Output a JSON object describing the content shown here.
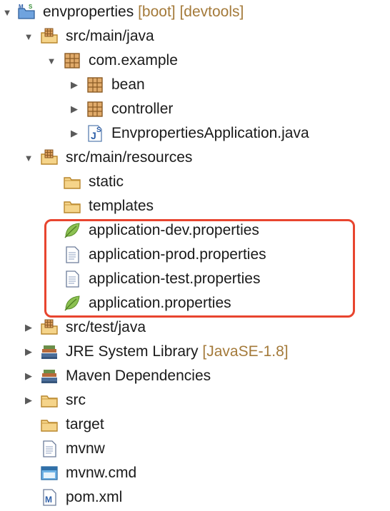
{
  "tree": [
    {
      "depth": 0,
      "arrow": "expanded",
      "icon": "maven-project-icon",
      "label": "envproperties",
      "decoration": "[boot] [devtools]"
    },
    {
      "depth": 1,
      "arrow": "expanded",
      "icon": "source-folder-icon",
      "label": "src/main/java",
      "decoration": ""
    },
    {
      "depth": 2,
      "arrow": "expanded",
      "icon": "package-icon",
      "label": "com.example",
      "decoration": ""
    },
    {
      "depth": 3,
      "arrow": "collapsed",
      "icon": "package-icon",
      "label": "bean",
      "decoration": ""
    },
    {
      "depth": 3,
      "arrow": "collapsed",
      "icon": "package-icon",
      "label": "controller",
      "decoration": ""
    },
    {
      "depth": 3,
      "arrow": "collapsed",
      "icon": "java-file-icon",
      "label": "EnvpropertiesApplication.java",
      "decoration": ""
    },
    {
      "depth": 1,
      "arrow": "expanded",
      "icon": "source-folder-icon",
      "label": "src/main/resources",
      "decoration": ""
    },
    {
      "depth": 2,
      "arrow": "none",
      "icon": "folder-icon",
      "label": "static",
      "decoration": ""
    },
    {
      "depth": 2,
      "arrow": "none",
      "icon": "folder-icon",
      "label": "templates",
      "decoration": ""
    },
    {
      "depth": 2,
      "arrow": "none",
      "icon": "spring-leaf-icon",
      "label": "application-dev.properties",
      "decoration": ""
    },
    {
      "depth": 2,
      "arrow": "none",
      "icon": "text-file-icon",
      "label": "application-prod.properties",
      "decoration": ""
    },
    {
      "depth": 2,
      "arrow": "none",
      "icon": "text-file-icon",
      "label": "application-test.properties",
      "decoration": ""
    },
    {
      "depth": 2,
      "arrow": "none",
      "icon": "spring-leaf-icon",
      "label": "application.properties",
      "decoration": ""
    },
    {
      "depth": 1,
      "arrow": "collapsed",
      "icon": "source-folder-icon",
      "label": "src/test/java",
      "decoration": ""
    },
    {
      "depth": 1,
      "arrow": "collapsed",
      "icon": "library-icon",
      "label": "JRE System Library",
      "decoration": "[JavaSE-1.8]"
    },
    {
      "depth": 1,
      "arrow": "collapsed",
      "icon": "library-icon",
      "label": "Maven Dependencies",
      "decoration": ""
    },
    {
      "depth": 1,
      "arrow": "collapsed",
      "icon": "folder-icon",
      "label": "src",
      "decoration": ""
    },
    {
      "depth": 1,
      "arrow": "none",
      "icon": "folder-icon",
      "label": "target",
      "decoration": ""
    },
    {
      "depth": 1,
      "arrow": "none",
      "icon": "text-file-icon",
      "label": "mvnw",
      "decoration": ""
    },
    {
      "depth": 1,
      "arrow": "none",
      "icon": "cmd-file-icon",
      "label": "mvnw.cmd",
      "decoration": ""
    },
    {
      "depth": 1,
      "arrow": "none",
      "icon": "maven-pom-icon",
      "label": "pom.xml",
      "decoration": ""
    }
  ],
  "colors": {
    "highlight_border": "#e8452f",
    "decoration_text": "#a47a3a",
    "folder": "#e9b95a",
    "package": "#c4884a",
    "spring_leaf": "#7cb342"
  }
}
